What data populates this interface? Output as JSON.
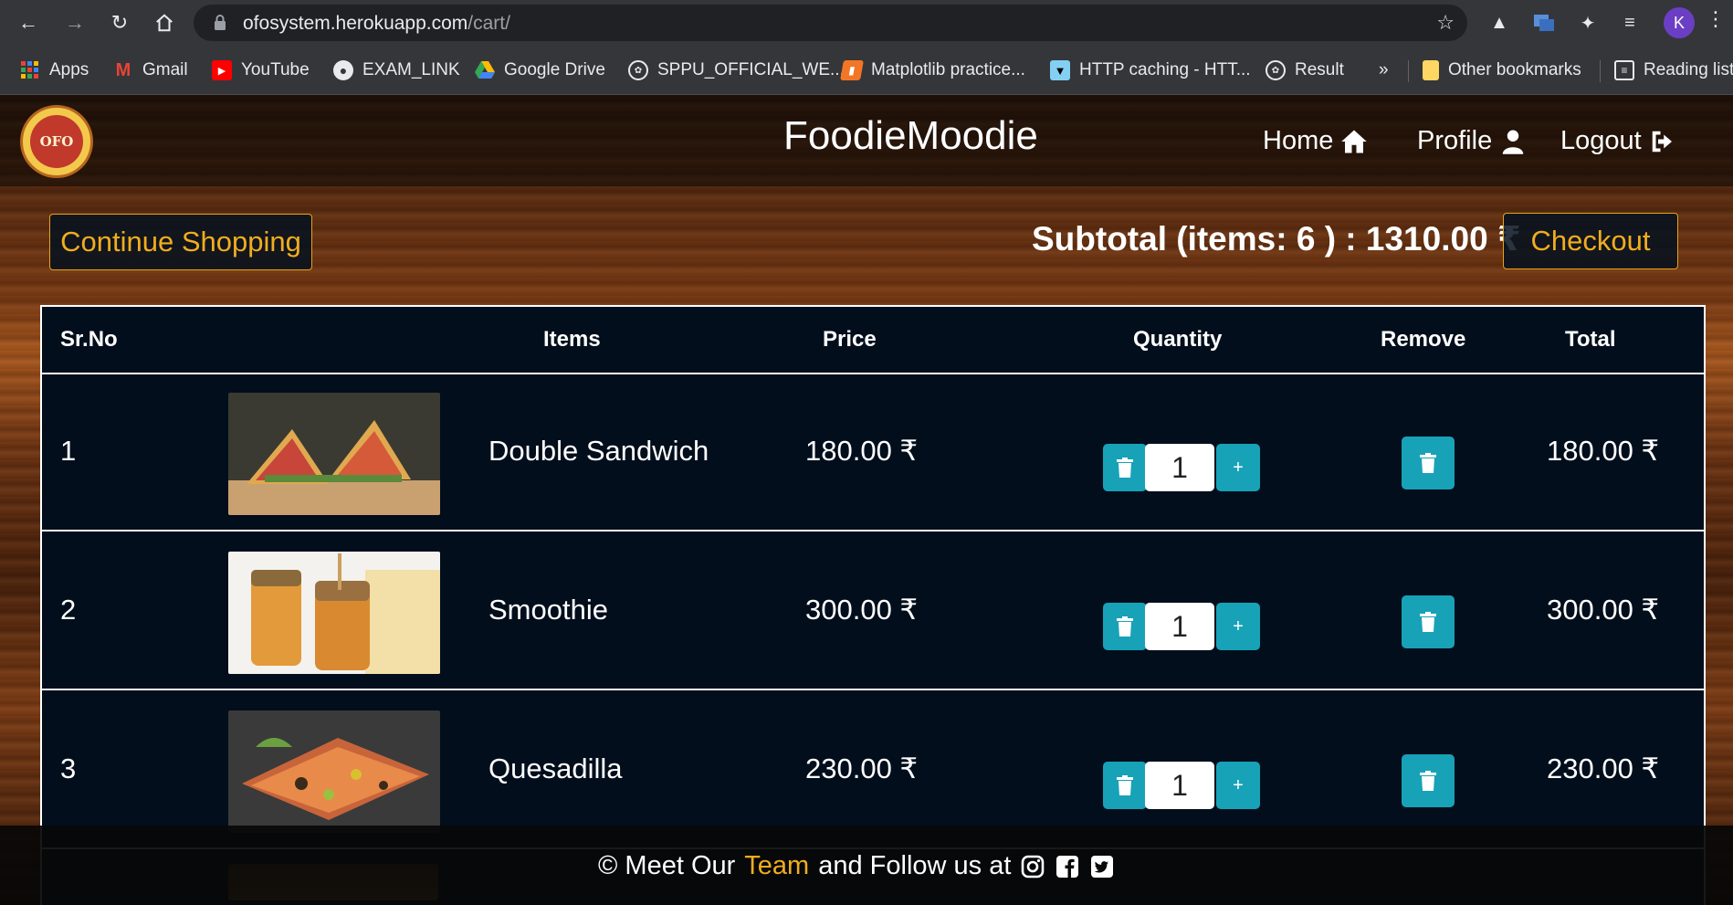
{
  "browser": {
    "url_host": "ofosystem.herokuapp.com",
    "url_path": "/cart/",
    "avatar_letter": "K",
    "bookmarks": [
      {
        "label": "Apps",
        "icon": "apps-grid-icon"
      },
      {
        "label": "Gmail",
        "icon": "gmail-icon"
      },
      {
        "label": "YouTube",
        "icon": "youtube-icon"
      },
      {
        "label": "EXAM_LINK",
        "icon": "globe-icon"
      },
      {
        "label": "Google Drive",
        "icon": "google-drive-icon"
      },
      {
        "label": "SPPU_OFFICIAL_WE...",
        "icon": "sppu-seal-icon"
      },
      {
        "label": "Matplotlib practice...",
        "icon": "notebook-icon"
      },
      {
        "label": "HTTP caching - HTT...",
        "icon": "mdn-icon"
      },
      {
        "label": "Result",
        "icon": "sppu-seal-icon"
      }
    ],
    "overflow_label": "»",
    "other_bookmarks": "Other bookmarks",
    "reading_list": "Reading list"
  },
  "site": {
    "logo_text": "OFO",
    "brand": "FoodieMoodie",
    "nav": [
      {
        "label": "Home",
        "icon": "home-icon"
      },
      {
        "label": "Profile",
        "icon": "user-icon"
      },
      {
        "label": "Logout",
        "icon": "sign-out-icon"
      }
    ]
  },
  "cart": {
    "continue_label": "Continue Shopping",
    "subtotal_text": "Subtotal (items: 6 ) : 1310.00 ₹",
    "checkout_label": "Checkout",
    "headers": {
      "srno": "Sr.No",
      "items": "Items",
      "price": "Price",
      "quantity": "Quantity",
      "remove": "Remove",
      "total": "Total"
    },
    "rows": [
      {
        "srno": "1",
        "name": "Double Sandwich",
        "price": "180.00 ₹",
        "qty": "1",
        "total": "180.00 ₹"
      },
      {
        "srno": "2",
        "name": "Smoothie",
        "price": "300.00 ₹",
        "qty": "1",
        "total": "300.00 ₹"
      },
      {
        "srno": "3",
        "name": "Quesadilla",
        "price": "230.00 ₹",
        "qty": "1",
        "total": "230.00 ₹"
      }
    ],
    "plus_label": "+"
  },
  "footer": {
    "prefix": "© Meet Our",
    "team": "Team",
    "suffix": "and Follow us at"
  },
  "colors": {
    "accent": "#f0ad1f",
    "action": "#17a2b8",
    "table_bg": "#020e1c"
  }
}
